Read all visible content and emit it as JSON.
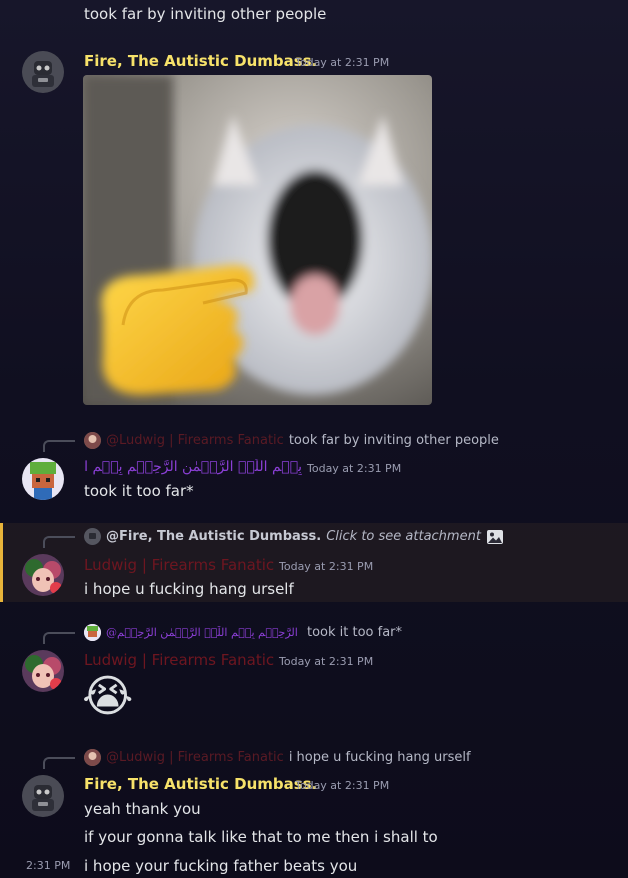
{
  "top_message": {
    "text": "took far by inviting other people"
  },
  "msg1": {
    "author": "Fire, The Autistic Dumbass.",
    "time": "Today at 2:31 PM"
  },
  "msg2": {
    "reply_to": "@Ludwig | Firearms Fanatic",
    "reply_text": "took far by inviting other people",
    "author": "بِسۡمِ اللّٰہِ الرَّحۡمٰنِ الرَّحِیۡمِ بِسۡمِ اللّٰہِ الرَّحۡمٰنِ الرَّحِیۡمِ",
    "time": "Today at 2:31 PM",
    "text": "took it too far*"
  },
  "msg3": {
    "reply_to": "@Fire, The Autistic Dumbass.",
    "reply_text": "Click to see attachment",
    "author": "Ludwig | Firearms Fanatic",
    "time": "Today at 2:31 PM",
    "text": "i hope u fucking hang urself"
  },
  "msg4": {
    "reply_to": "@بِسۡمِ اللّٰہِ الرَّحۡمٰنِ الرَّحِیۡمِ بِسۡمِ اللّٰہِ الرَّحۡمٰنِ الرَّحِیۡمِ",
    "reply_text": "took it too far*",
    "author": "Ludwig | Firearms Fanatic",
    "time": "Today at 2:31 PM",
    "emoji": "😭"
  },
  "msg5": {
    "reply_to": "@Ludwig | Firearms Fanatic",
    "reply_text": "i hope u fucking hang urself",
    "author": "Fire, The Autistic Dumbass.",
    "time": "Today at 2:31 PM",
    "lines": [
      "yeah thank you",
      "if your gonna talk like that to me then i shall to"
    ]
  },
  "msg6": {
    "time": "2:31 PM",
    "text": "i hope your fucking father beats you"
  },
  "colors": {
    "fire_name": "#f7e26a",
    "ludwig_name": "#6e1620",
    "arabic_name": "#8b3fd6",
    "highlight_bar": "#e8b43a"
  },
  "icons": {
    "attachment": "image-icon"
  }
}
